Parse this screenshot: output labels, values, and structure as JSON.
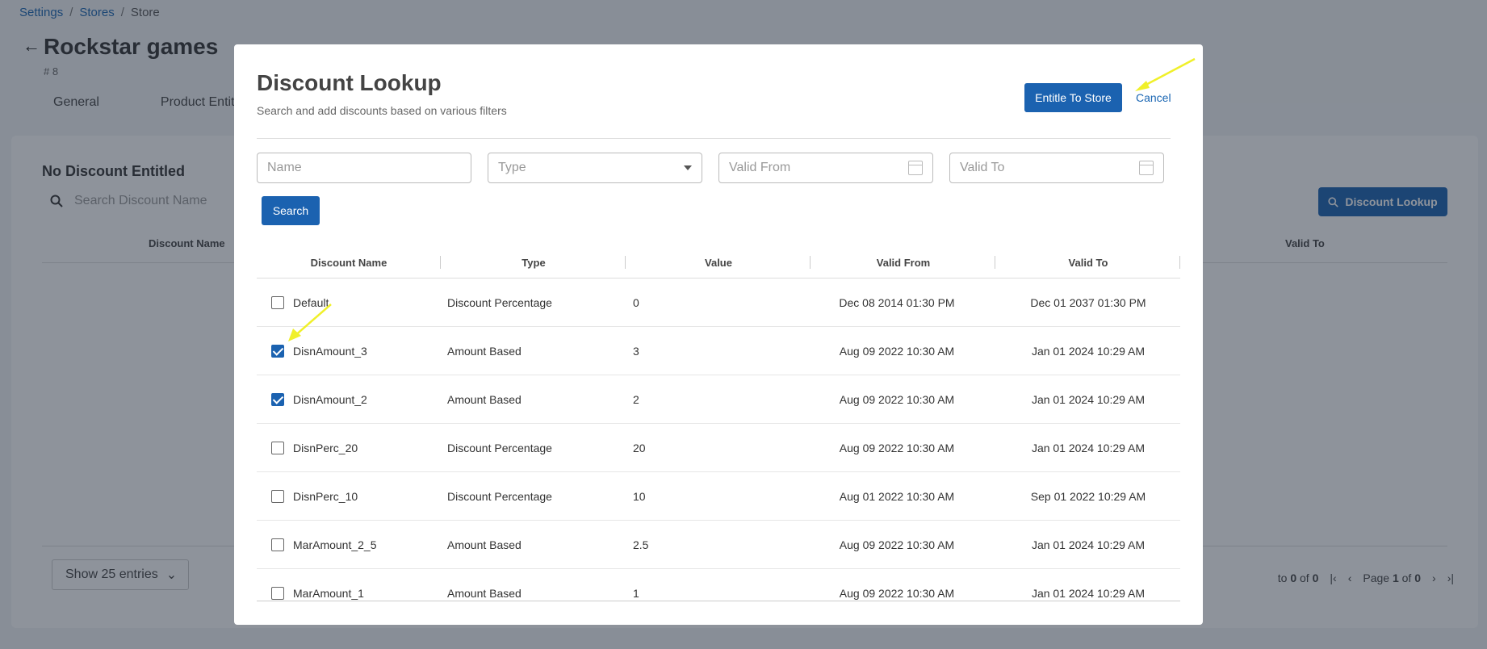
{
  "breadcrumb": {
    "settings": "Settings",
    "stores": "Stores",
    "current": "Store",
    "sep": "/"
  },
  "page": {
    "title": "Rockstar games",
    "store_id": "# 8"
  },
  "tabs": [
    "General",
    "Product Entit"
  ],
  "background_card": {
    "heading": "No Discount Entitled",
    "search_placeholder": "Search Discount Name",
    "lookup_button": "Discount Lookup",
    "col_discount_name": "Discount Name",
    "col_valid_to": "Valid To",
    "entries_select": "Show 25 entries",
    "pager_count_prefix": "to",
    "pager_count_a": "0",
    "pager_count_of": "of",
    "pager_count_b": "0",
    "page_label": "Page",
    "page_current": "1",
    "page_of": "of",
    "page_total": "0"
  },
  "modal": {
    "title": "Discount Lookup",
    "subtitle": "Search and add discounts based on various filters",
    "entitle_button": "Entitle To Store",
    "cancel_link": "Cancel",
    "filters": {
      "name_placeholder": "Name",
      "type_placeholder": "Type",
      "valid_from_placeholder": "Valid From",
      "valid_to_placeholder": "Valid To"
    },
    "search_button": "Search",
    "columns": [
      "Discount Name",
      "Type",
      "Value",
      "Valid From",
      "Valid To"
    ],
    "rows": [
      {
        "checked": false,
        "name": "Default",
        "type": "Discount Percentage",
        "value": "0",
        "valid_from": "Dec 08 2014 01:30 PM",
        "valid_to": "Dec 01 2037 01:30 PM"
      },
      {
        "checked": true,
        "name": "DisnAmount_3",
        "type": "Amount Based",
        "value": "3",
        "valid_from": "Aug 09 2022 10:30 AM",
        "valid_to": "Jan 01 2024 10:29 AM"
      },
      {
        "checked": true,
        "name": "DisnAmount_2",
        "type": "Amount Based",
        "value": "2",
        "valid_from": "Aug 09 2022 10:30 AM",
        "valid_to": "Jan 01 2024 10:29 AM"
      },
      {
        "checked": false,
        "name": "DisnPerc_20",
        "type": "Discount Percentage",
        "value": "20",
        "valid_from": "Aug 09 2022 10:30 AM",
        "valid_to": "Jan 01 2024 10:29 AM"
      },
      {
        "checked": false,
        "name": "DisnPerc_10",
        "type": "Discount Percentage",
        "value": "10",
        "valid_from": "Aug 01 2022 10:30 AM",
        "valid_to": "Sep 01 2022 10:29 AM"
      },
      {
        "checked": false,
        "name": "MarAmount_2_5",
        "type": "Amount Based",
        "value": "2.5",
        "valid_from": "Aug 09 2022 10:30 AM",
        "valid_to": "Jan 01 2024 10:29 AM"
      },
      {
        "checked": false,
        "name": "MarAmount_1",
        "type": "Amount Based",
        "value": "1",
        "valid_from": "Aug 09 2022 10:30 AM",
        "valid_to": "Jan 01 2024 10:29 AM"
      }
    ]
  },
  "colors": {
    "primary": "#1b62b0",
    "annotation_arrow": "#f0f02a"
  }
}
